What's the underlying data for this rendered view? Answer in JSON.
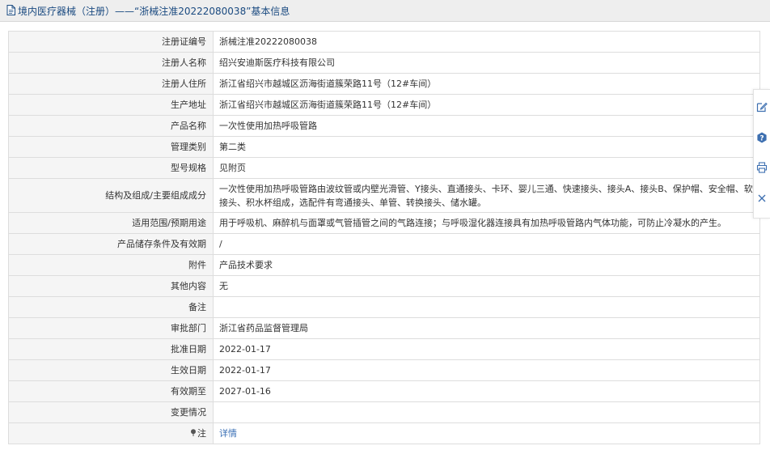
{
  "header": {
    "title": "境内医疗器械（注册）——“浙械注准20222080038”基本信息"
  },
  "rows": [
    {
      "label": "注册证编号",
      "value": "浙械注准20222080038"
    },
    {
      "label": "注册人名称",
      "value": "绍兴安迪斯医疗科技有限公司"
    },
    {
      "label": "注册人住所",
      "value": "浙江省绍兴市越城区沥海街道簇荣路11号（12#车间）"
    },
    {
      "label": "生产地址",
      "value": "浙江省绍兴市越城区沥海街道簇荣路11号（12#车间）"
    },
    {
      "label": "产品名称",
      "value": "一次性使用加热呼吸管路"
    },
    {
      "label": "管理类别",
      "value": "第二类"
    },
    {
      "label": "型号规格",
      "value": "见附页"
    },
    {
      "label": "结构及组成/主要组成成分",
      "value": "一次性使用加热呼吸管路由波纹管或内壁光滑管、Y接头、直通接头、卡环、婴儿三通、快速接头、接头A、接头B、保护帽、安全帽、软接头、积水杯组成，选配件有弯通接头、单管、转换接头、储水罐。"
    },
    {
      "label": "适用范围/预期用途",
      "value": "用于呼吸机、麻醉机与面罩或气管插管之间的气路连接；与呼吸湿化器连接具有加热呼吸管路内气体功能，可防止冷凝水的产生。"
    },
    {
      "label": "产品储存条件及有效期",
      "value": "/"
    },
    {
      "label": "附件",
      "value": "产品技术要求"
    },
    {
      "label": "其他内容",
      "value": "无"
    },
    {
      "label": "备注",
      "value": ""
    },
    {
      "label": "审批部门",
      "value": "浙江省药品监督管理局"
    },
    {
      "label": "批准日期",
      "value": "2022-01-17"
    },
    {
      "label": "生效日期",
      "value": "2022-01-17"
    },
    {
      "label": "有效期至",
      "value": "2027-01-16"
    },
    {
      "label": "变更情况",
      "value": ""
    }
  ],
  "note_row": {
    "label": "注",
    "link": "详情"
  },
  "icons": {
    "title": "document-icon",
    "note": "pin-icon",
    "side": [
      "edit-icon",
      "help-icon",
      "print-icon",
      "close-icon"
    ]
  },
  "colors": {
    "title_text": "#1a4a80",
    "link": "#3a6fb5",
    "tool_icon": "#3d6fb0"
  }
}
